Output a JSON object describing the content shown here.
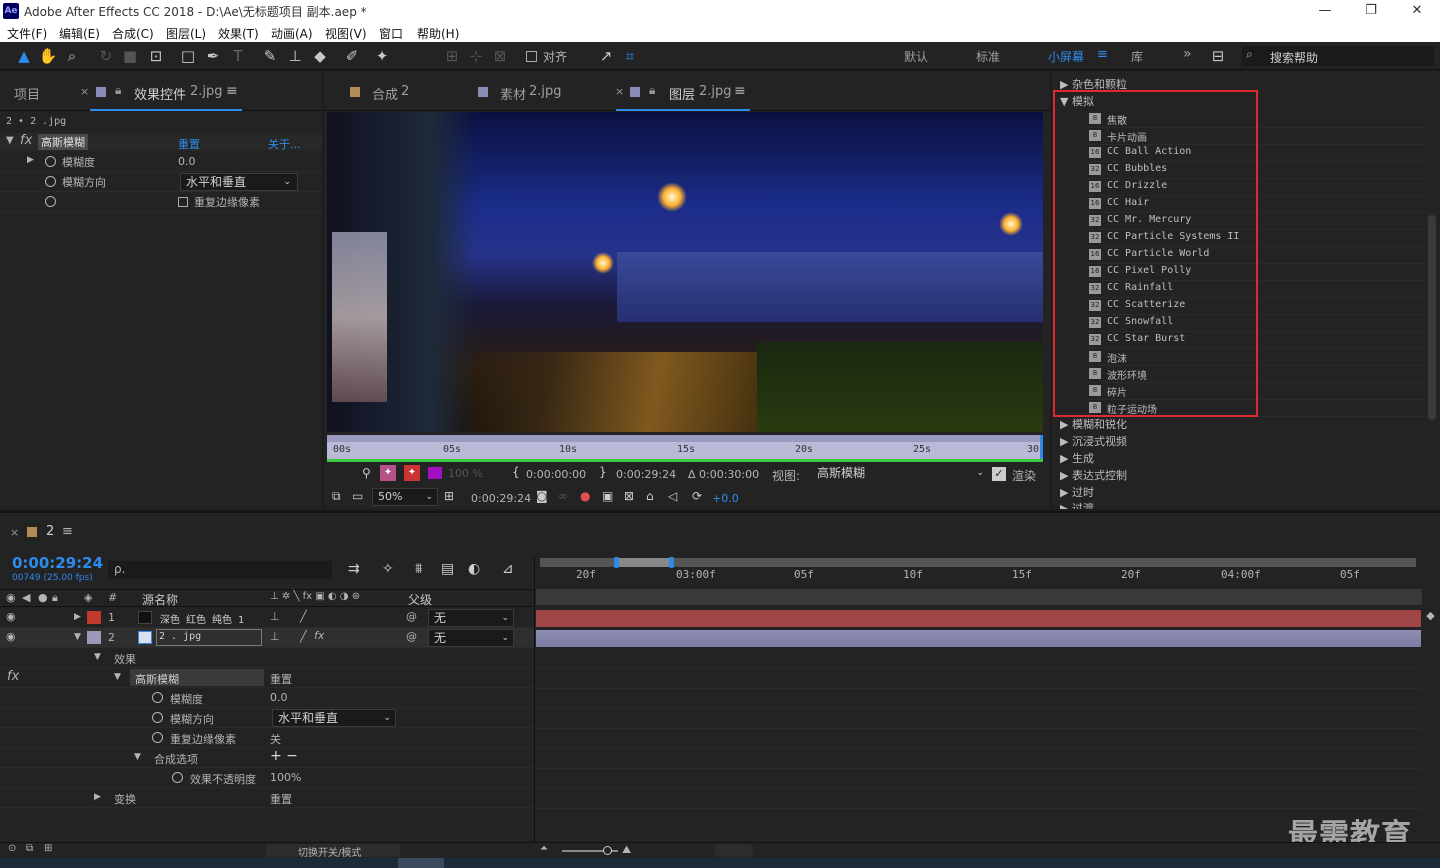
{
  "window": {
    "title": "Adobe After Effects CC 2018 - D:\\Ae\\无标题项目 副本.aep *",
    "logo": "Ae",
    "min": "—",
    "max": "❐",
    "close": "✕"
  },
  "menu": [
    "文件(F)",
    "编辑(E)",
    "合成(C)",
    "图层(L)",
    "效果(T)",
    "动画(A)",
    "视图(V)",
    "窗口",
    "帮助(H)"
  ],
  "toolbar": {
    "snap_label": "对齐",
    "workspaces": [
      "默认",
      "标准",
      "小屏幕",
      "库"
    ],
    "active_workspace": "小屏幕",
    "more": "»",
    "search_placeholder": "搜索帮助"
  },
  "project_panel": {
    "tab_project": "项目",
    "tab_effects": "效果控件",
    "tab_effects_file": "2.jpg",
    "breadcrumb": "2 • 2 .jpg",
    "effect_name": "高斯模糊",
    "reset": "重置",
    "about": "关于...",
    "props": {
      "blur_label": "模糊度",
      "blur_value": "0.0",
      "dir_label": "模糊方向",
      "dir_value": "水平和垂直",
      "repeat_label": "重复边缘像素"
    }
  },
  "viewer": {
    "tabs": [
      {
        "label": "合成",
        "file": "2",
        "color": "#b48c5a"
      },
      {
        "label": "素材",
        "file": "2.jpg",
        "color": "#8a8ab4"
      },
      {
        "label": "图层",
        "file": "2.jpg",
        "color": "#8a8ab4"
      }
    ],
    "ruler": [
      "00s",
      "05s",
      "10s",
      "15s",
      "20s",
      "25s",
      "30"
    ],
    "opacity": "100 %",
    "in_point": "0:00:00:00",
    "out_point": "0:00:29:24",
    "duration": "Δ 0:00:30:00",
    "view_label": "视图:",
    "view_value": "高斯模糊",
    "render_label": "渲染",
    "zoom": "50%",
    "timecode": "0:00:29:24",
    "exposure": "+0.0"
  },
  "effects_panel": {
    "categories_top": [
      "杂色和颗粒",
      "模拟"
    ],
    "items": [
      "焦散",
      "卡片动画",
      "CC Ball Action",
      "CC Bubbles",
      "CC Drizzle",
      "CC Hair",
      "CC Mr. Mercury",
      "CC Particle Systems II",
      "CC Particle World",
      "CC Pixel Polly",
      "CC Rainfall",
      "CC Scatterize",
      "CC Snowfall",
      "CC Star Burst",
      "泡沫",
      "波形环境",
      "碎片",
      "粒子运动场"
    ],
    "badges": [
      "8",
      "8",
      "16",
      "32",
      "16",
      "16",
      "32",
      "32",
      "16",
      "16",
      "32",
      "32",
      "32",
      "32",
      "8",
      "8",
      "8",
      "8"
    ],
    "categories_bottom": [
      "模糊和锐化",
      "沉浸式视频",
      "生成",
      "表达式控制",
      "过时",
      "过渡"
    ]
  },
  "timeline": {
    "comp_name": "2",
    "timecode": "0:00:29:24",
    "fps": "00749 (25.00 fps)",
    "search_placeholder": "ρ.",
    "col_source": "源名称",
    "col_num": "#",
    "col_parent": "父级",
    "layers": [
      {
        "num": "1",
        "name": "深色 红色 纯色 1",
        "parent": "无",
        "color": "#c0392b"
      },
      {
        "num": "2",
        "name": "2 . jpg",
        "parent": "无",
        "color": "#9a9ab8"
      }
    ],
    "effects_label": "效果",
    "effect_name": "高斯模糊",
    "reset": "重置",
    "blur_label": "模糊度",
    "blur_value": "0.0",
    "dir_label": "模糊方向",
    "dir_value": "水平和垂直",
    "repeat_label": "重复边缘像素",
    "repeat_value": "关",
    "comp_options": "合成选项",
    "comp_options_value": "+ −",
    "opacity_label": "效果不透明度",
    "opacity_value": "100%",
    "transform_label": "变换",
    "transform_value": "重置",
    "ticks": [
      "20f",
      "03:00f",
      "05f",
      "10f",
      "15f",
      "20f",
      "04:00f",
      "05f"
    ],
    "toggle_label": "切换开关/模式",
    "fx": "fx"
  },
  "watermark": "最需教育",
  "colors": {
    "accent": "#2d8ceb",
    "highlight_box": "#e0282e",
    "layer1_bar": "#a04545",
    "layer2_bar": "#7d7da3"
  }
}
